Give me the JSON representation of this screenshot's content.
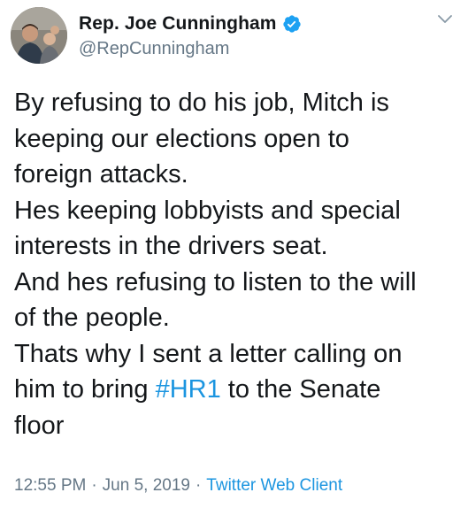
{
  "colors": {
    "text": "#14171a",
    "secondary": "#657786",
    "link": "#1b95e0",
    "verified": "#1da1f2"
  },
  "author": {
    "display_name": "Rep. Joe Cunningham",
    "handle": "@RepCunningham",
    "verified_icon": "verified-badge-icon",
    "avatar_icon": "profile-photo"
  },
  "menu": {
    "icon": "chevron-down-icon"
  },
  "tweet": {
    "line_1": "By refusing to do his job, Mitch is",
    "line_2": "keeping our elections open to",
    "line_3": "foreign attacks.",
    "line_4": "Hes keeping lobbyists and special",
    "line_5": "interests in the drivers seat.",
    "line_6": "And hes refusing to listen to the will",
    "line_7": "of the people.",
    "line_8": "Thats why I sent a letter calling on",
    "line_9_before": "him to bring ",
    "hashtag": "#HR1",
    "line_9_after": " to the Senate",
    "line_10": "floor"
  },
  "meta": {
    "time": "12:55 PM",
    "separator_1": "·",
    "date": "Jun 5, 2019",
    "separator_2": "·",
    "source": "Twitter Web Client"
  }
}
